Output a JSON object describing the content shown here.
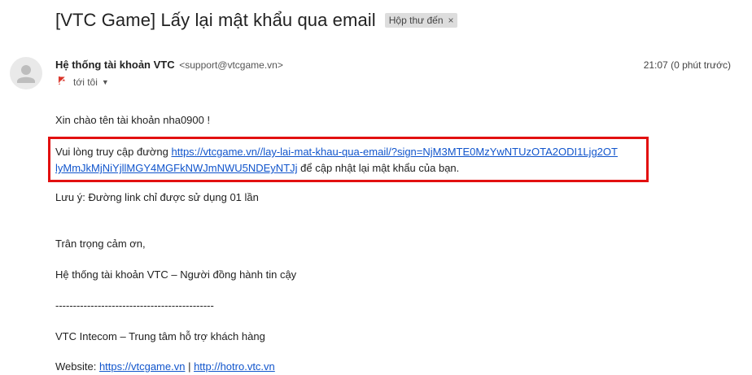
{
  "email": {
    "subject": "[VTC Game] Lấy lại mật khẩu qua email",
    "label_chip": "Hộp thư đến",
    "label_close": "×",
    "sender_name": "Hệ thống tài khoản VTC",
    "sender_email": "<support@vtcgame.vn>",
    "recipient_text": "tới tôi",
    "timestamp": "21:07 (0 phút trước)",
    "greeting": "Xin chào tên tài khoản nha0900 !",
    "link_intro": "Vui lòng truy cập đường ",
    "link_line1": "https://vtcgame.vn//lay-lai-mat-khau-qua-email/?sign=NjM3MTE0MzYwNTUzOTA2ODI1Ljg2OT",
    "link_line2": "lyMmJkMjNiYjllMGY4MGFkNWJmNWU5NDEyNTJj",
    "link_outro": " để cập nhật lại mật khẩu của bạn.",
    "note": "Lưu ý: Đường link chỉ được sử dụng 01 lần",
    "thanks": "Trân trọng cảm ơn,",
    "signature": "Hệ thống tài khoản VTC – Người đồng hành tin cậy",
    "divider": "---------------------------------------------",
    "company": "VTC Intecom – Trung tâm hỗ trợ khách hàng",
    "website_label": "Website: ",
    "website_link1": "https://vtcgame.vn",
    "website_sep": " | ",
    "website_link2": "http://hotro.vtc.vn"
  },
  "icons": {
    "avatar": "person-avatar-icon",
    "recipient": "flag-icon",
    "dropdown": "chevron-down-icon"
  },
  "colors": {
    "link": "#1155cc",
    "highlight_border": "#e21010",
    "chip_bg": "#dddddd"
  }
}
